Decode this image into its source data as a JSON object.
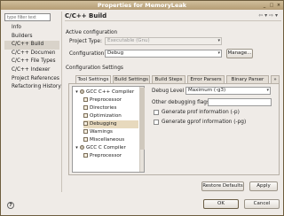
{
  "window": {
    "title": "Properties for MemoryLeak",
    "buttons": [
      "_",
      "□",
      "×"
    ]
  },
  "filter": {
    "placeholder": "type filter text"
  },
  "nav": {
    "items": [
      {
        "label": "Info"
      },
      {
        "label": "Builders"
      },
      {
        "label": "C/C++ Build",
        "selected": true
      },
      {
        "label": "C/C++ Documen"
      },
      {
        "label": "C/C++ File Types"
      },
      {
        "label": "C/C++ Indexer"
      },
      {
        "label": "Project References"
      },
      {
        "label": "Refactoring History"
      }
    ]
  },
  "page": {
    "heading": "C/C++ Build",
    "header_icons": "⇦ ▾ ⇨ ▾"
  },
  "active_config": {
    "group_label": "Active configuration",
    "project_type_label": "Project Type:",
    "project_type_value": "Executable (Gnu)",
    "configuration_label": "Configuration:",
    "configuration_value": "Debug",
    "manage_button": "Manage..."
  },
  "config_settings": {
    "label": "Configuration Settings"
  },
  "tabs": [
    {
      "label": "Tool Settings",
      "active": true
    },
    {
      "label": "Build Settings"
    },
    {
      "label": "Build Steps"
    },
    {
      "label": "Error Parsers"
    },
    {
      "label": "Binary Parser"
    }
  ],
  "tree": {
    "items": [
      {
        "label": "GCC C++ Compiler",
        "level": 0,
        "expanded": true
      },
      {
        "label": "Preprocessor",
        "level": 1
      },
      {
        "label": "Directories",
        "level": 1
      },
      {
        "label": "Optimization",
        "level": 1
      },
      {
        "label": "Debugging",
        "level": 1,
        "selected": true
      },
      {
        "label": "Warnings",
        "level": 1
      },
      {
        "label": "Miscellaneous",
        "level": 1
      },
      {
        "label": "GCC C Compiler",
        "level": 0,
        "expanded": true
      },
      {
        "label": "Preprocessor",
        "level": 1
      }
    ]
  },
  "debug": {
    "level_label": "Debug Level",
    "level_value": "Maximum (-g3)",
    "other_flags_label": "Other debugging flags",
    "other_flags_value": "",
    "gprof_label": "Generate prof information (-p)",
    "gprof2_label": "Generate gprof information (-pg)"
  },
  "footer": {
    "restore_defaults": "Restore Defaults",
    "apply": "Apply",
    "ok": "OK",
    "cancel": "Cancel",
    "help": "?"
  }
}
